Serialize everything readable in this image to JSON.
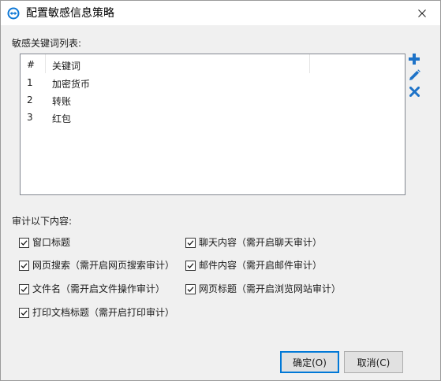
{
  "window": {
    "title": "配置敏感信息策略"
  },
  "keywords": {
    "label": "敏感关键词列表:",
    "headers": {
      "number": "#",
      "keyword": "关键词"
    },
    "rows": [
      {
        "num": "1",
        "keyword": "加密货币"
      },
      {
        "num": "2",
        "keyword": "转账"
      },
      {
        "num": "3",
        "keyword": "红包"
      }
    ]
  },
  "audit": {
    "label": "审计以下内容:",
    "options": [
      {
        "label": "窗口标题",
        "checked": true
      },
      {
        "label": "聊天内容（需开启聊天审计）",
        "checked": true
      },
      {
        "label": "网页搜索（需开启网页搜索审计）",
        "checked": true
      },
      {
        "label": "邮件内容（需开启邮件审计）",
        "checked": true
      },
      {
        "label": "文件名（需开启文件操作审计）",
        "checked": true
      },
      {
        "label": "网页标题（需开启浏览网站审计）",
        "checked": true
      },
      {
        "label": "打印文档标题（需开启打印审计）",
        "checked": true
      }
    ]
  },
  "buttons": {
    "ok": "确定(O)",
    "cancel": "取消(C)"
  },
  "icons": {
    "add": "plus-icon",
    "edit": "pencil-icon",
    "delete": "x-icon",
    "app": "app-icon",
    "close": "close-icon"
  },
  "colors": {
    "accent": "#1e73c8",
    "title_icon": "#0e78d6"
  }
}
